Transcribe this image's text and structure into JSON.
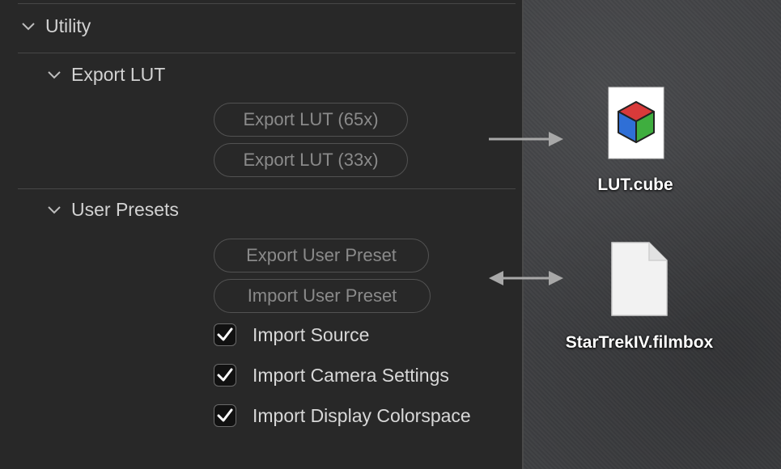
{
  "utility": {
    "title": "Utility",
    "export_lut": {
      "title": "Export LUT",
      "buttons": [
        "Export LUT (65x)",
        "Export LUT (33x)"
      ]
    },
    "user_presets": {
      "title": "User Presets",
      "buttons": [
        "Export User Preset",
        "Import User Preset"
      ],
      "checkboxes": [
        {
          "label": "Import Source",
          "checked": true
        },
        {
          "label": "Import Camera Settings",
          "checked": true
        },
        {
          "label": "Import Display Colorspace",
          "checked": true
        }
      ]
    }
  },
  "desktop": {
    "files": [
      {
        "name": "LUT.cube",
        "icon": "cube-file-icon"
      },
      {
        "name": "StarTrekIV.filmbox",
        "icon": "document-file-icon"
      }
    ]
  },
  "colors": {
    "panel_bg": "#282828",
    "desktop_bg": "#3e3f42",
    "cube_red": "#d93a3a",
    "cube_green": "#3fae3f",
    "cube_blue": "#2f6fd6"
  }
}
